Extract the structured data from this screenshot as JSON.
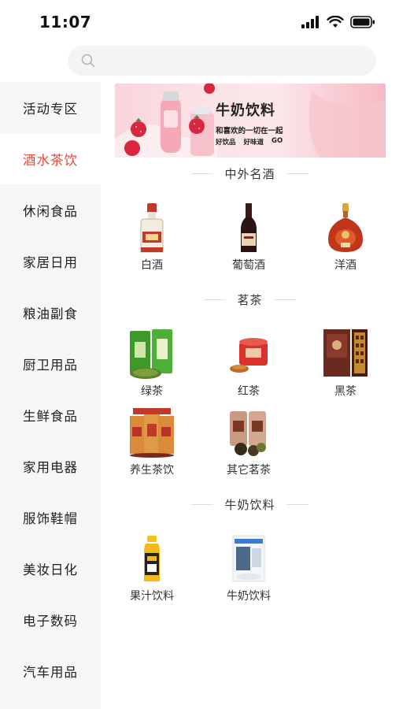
{
  "status": {
    "time": "11:07"
  },
  "search": {
    "placeholder": ""
  },
  "sidebar": {
    "active_color": "#e8473c",
    "items": [
      {
        "label": "活动专区"
      },
      {
        "label": "酒水茶饮",
        "active": true
      },
      {
        "label": "休闲食品"
      },
      {
        "label": "家居日用"
      },
      {
        "label": "粮油副食"
      },
      {
        "label": "厨卫用品"
      },
      {
        "label": "生鲜食品"
      },
      {
        "label": "家用电器"
      },
      {
        "label": "服饰鞋帽"
      },
      {
        "label": "美妆日化"
      },
      {
        "label": "电子数码"
      },
      {
        "label": "汽车用品"
      }
    ]
  },
  "banner": {
    "title": "牛奶饮料",
    "subtitle": "和喜欢的一切在一起",
    "tags": [
      "好饮品",
      "好味道",
      "GO"
    ]
  },
  "sections": [
    {
      "title": "中外名酒",
      "items": [
        {
          "label": "白酒",
          "icon": "baijiu-bottle-icon"
        },
        {
          "label": "葡萄酒",
          "icon": "wine-bottle-icon"
        },
        {
          "label": "洋酒",
          "icon": "cognac-bottle-icon"
        }
      ]
    },
    {
      "title": "茗茶",
      "items": [
        {
          "label": "绿茶",
          "icon": "green-tea-icon"
        },
        {
          "label": "红茶",
          "icon": "black-tea-icon"
        },
        {
          "label": "黑茶",
          "icon": "dark-tea-icon"
        },
        {
          "label": "养生茶饮",
          "icon": "health-tea-icon"
        },
        {
          "label": "其它茗茶",
          "icon": "other-tea-icon"
        }
      ]
    },
    {
      "title": "牛奶饮料",
      "items": [
        {
          "label": "果汁饮料",
          "icon": "juice-bottle-icon"
        },
        {
          "label": "牛奶饮料",
          "icon": "milk-carton-icon"
        }
      ]
    }
  ]
}
